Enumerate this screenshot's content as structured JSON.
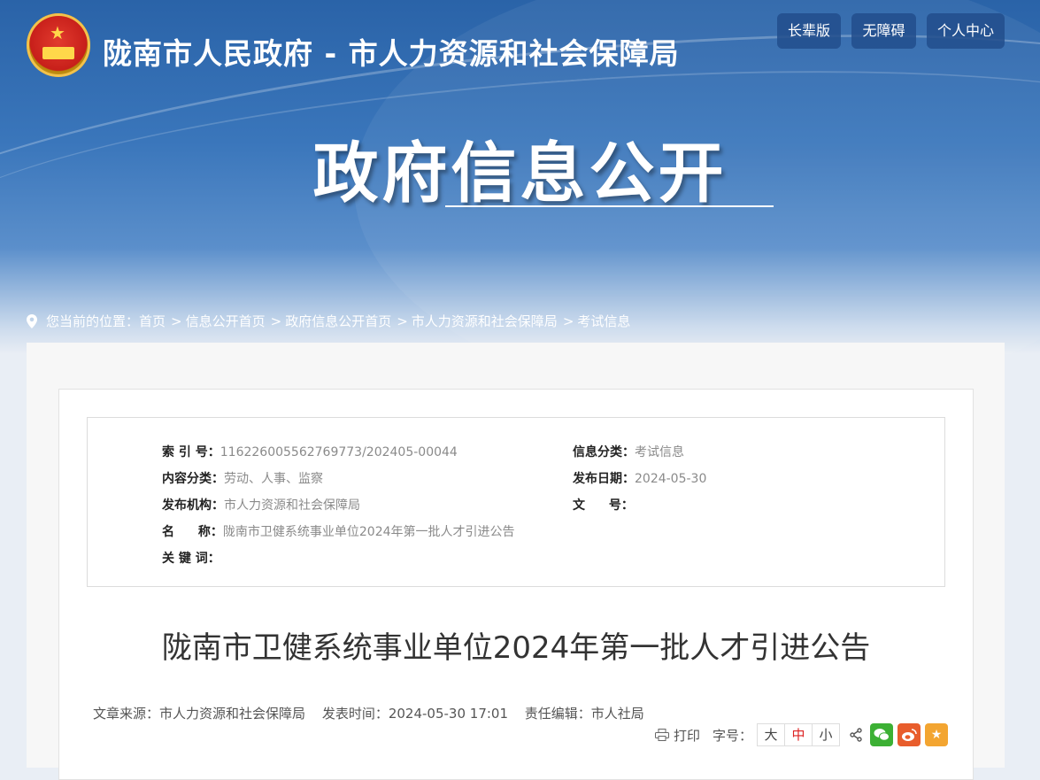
{
  "header": {
    "site_title": "陇南市人民政府 - 市人力资源和社会保障局",
    "buttons": [
      "长辈版",
      "无障碍",
      "个人中心"
    ]
  },
  "banner": {
    "title": "政府信息公开"
  },
  "breadcrumb": {
    "prefix": "您当前的位置：",
    "items": [
      "首页",
      "信息公开首页",
      "政府信息公开首页",
      "市人力资源和社会保障局",
      "考试信息"
    ]
  },
  "meta": {
    "index_no_label": "索 引 号：",
    "index_no": "116226005562769773/202405-00044",
    "category_label": "信息分类：",
    "category": "考试信息",
    "content_class_label": "内容分类：",
    "content_class": "劳动、人事、监察",
    "publish_date_label": "发布日期：",
    "publish_date": "2024-05-30",
    "publisher_label": "发布机构：",
    "publisher": "市人力资源和社会保障局",
    "doc_no_label": "文 号：",
    "doc_no": "",
    "name_label": "名 称：",
    "name": "陇南市卫健系统事业单位2024年第一批人才引进公告",
    "keywords_label": "关 键 词：",
    "keywords": ""
  },
  "article": {
    "title": "陇南市卫健系统事业单位2024年第一批人才引进公告",
    "source_label": "文章来源：",
    "source": "市人力资源和社会保障局",
    "time_label": "发表时间：",
    "time": "2024-05-30 17:01",
    "editor_label": "责任编辑：",
    "editor": "市人社局"
  },
  "tools": {
    "print": "打印",
    "font_label": "字号：",
    "sizes": [
      "大",
      "中",
      "小"
    ],
    "active_size": "中"
  },
  "colors": {
    "banner_dark": "#2a63a8",
    "wechat": "#3cb034",
    "weibo": "#e85d2c",
    "favorite": "#f3a531"
  }
}
